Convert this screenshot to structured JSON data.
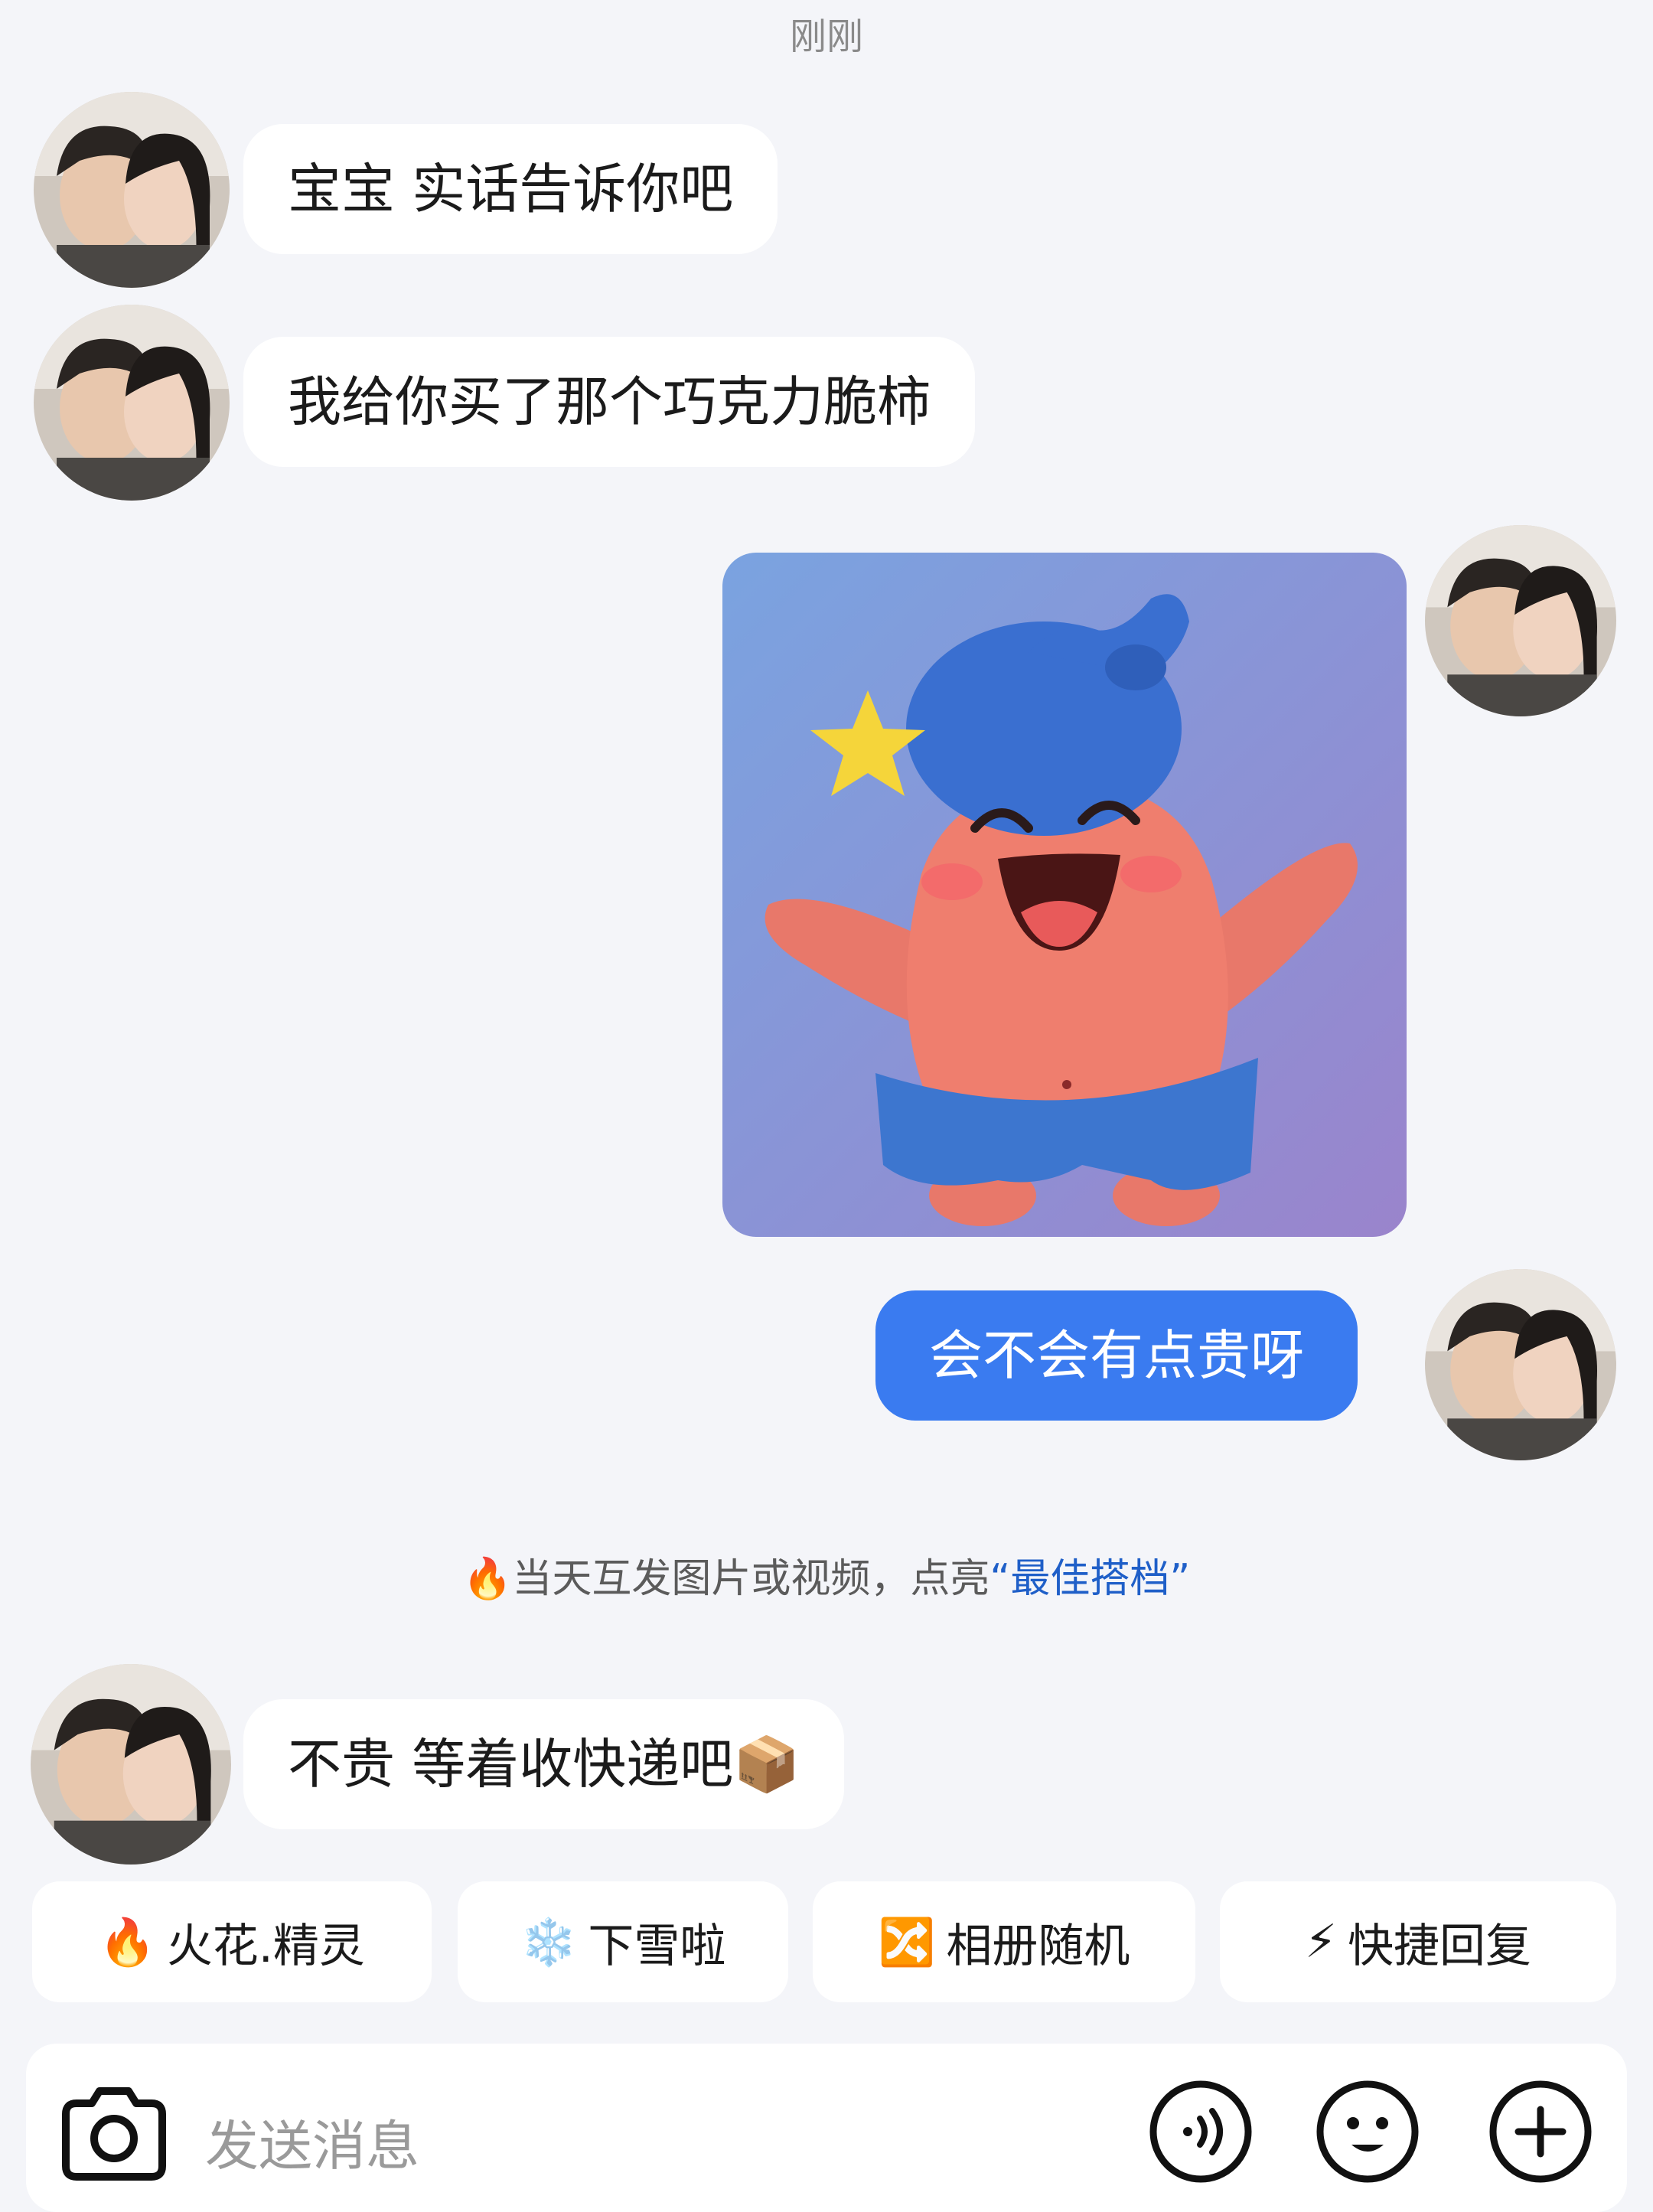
{
  "timestamp": "刚刚",
  "messages": [
    {
      "side": "left",
      "text": "宝宝 实话告诉你吧"
    },
    {
      "side": "left",
      "text": "我给你买了那个巧克力脆柿"
    },
    {
      "side": "right",
      "type": "sticker",
      "description": "patrick-star-sticker"
    },
    {
      "side": "right",
      "text": "会不会有点贵呀"
    },
    {
      "side": "left",
      "text": "不贵 等着收快递吧📦"
    }
  ],
  "notice": {
    "prefix": "🔥当天互发图片或视频，点亮",
    "highlight": "“最佳搭档”"
  },
  "quick_actions": [
    {
      "icon": "🔥",
      "label": "火花.精灵"
    },
    {
      "icon": "❄️",
      "label": "下雪啦"
    },
    {
      "icon": "🔀",
      "label": "相册随机"
    },
    {
      "icon": "⚡",
      "label": "快捷回复"
    }
  ],
  "input": {
    "placeholder": "发送消息"
  },
  "colors": {
    "accent": "#3a7bf0",
    "highlight": "#1f5fc8",
    "background": "#f4f5f9"
  },
  "icons": [
    "camera-icon",
    "voice-icon",
    "emoji-icon",
    "plus-icon"
  ]
}
